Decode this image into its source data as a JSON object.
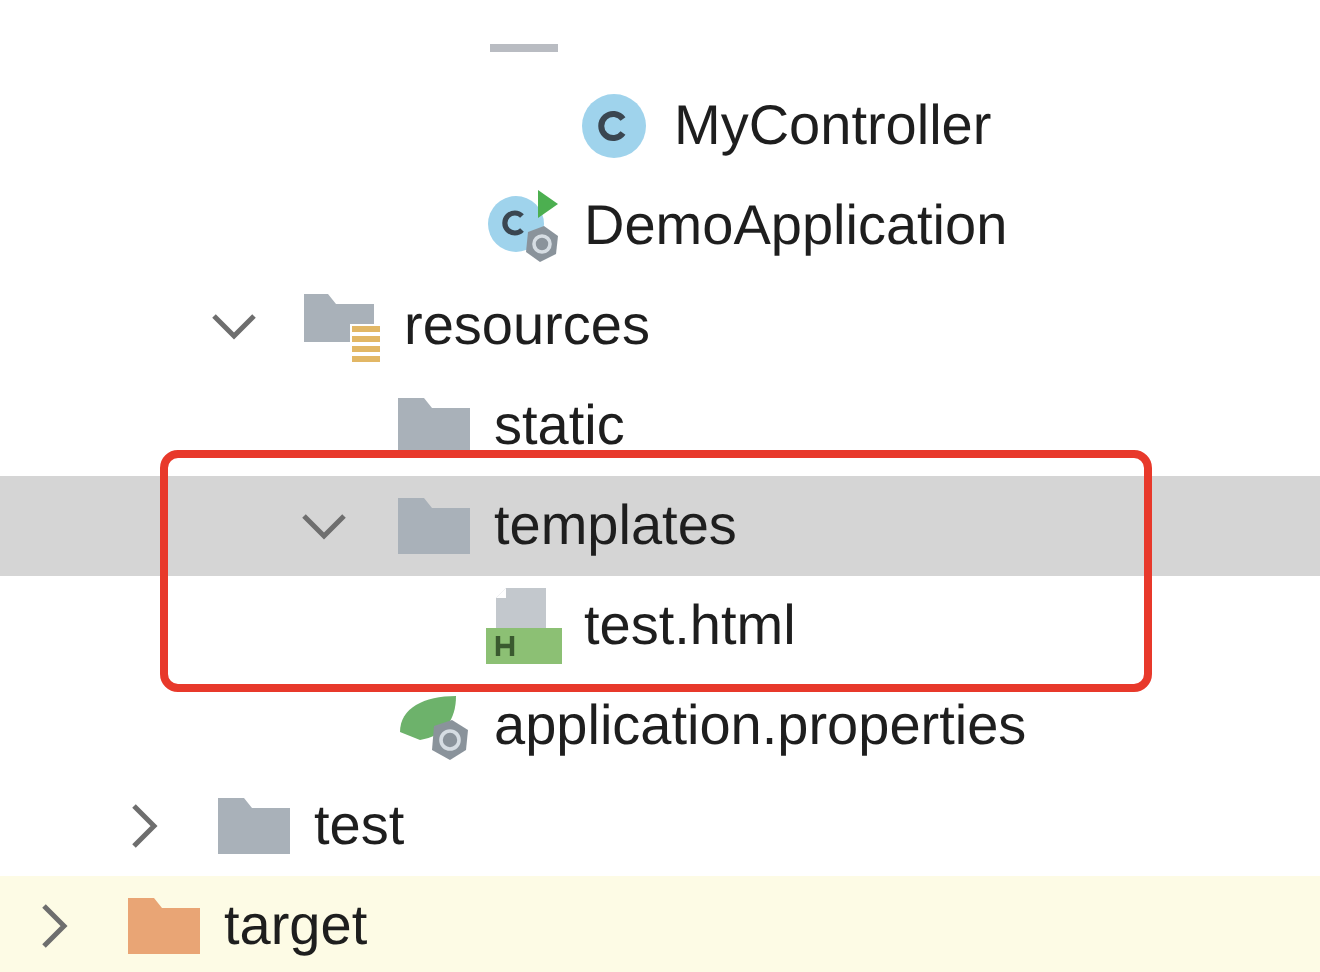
{
  "project_tree": [
    {
      "children": [
        {
          "children": [
            {
              "children": [
                {
                  "children": [
                    {
                      "kind": "package",
                      "children": [
                        {
                          "kind": "class",
                          "label": "MyController",
                          "selected": false
                        }
                      ]
                    },
                    {
                      "kind": "spring-app",
                      "label": "DemoApplication",
                      "selected": false
                    }
                  ]
                }
              ]
            },
            {
              "kind": "resources-folder",
              "label": "resources",
              "expanded": true,
              "selected": false,
              "children": [
                {
                  "kind": "folder",
                  "label": "static",
                  "selected": false
                },
                {
                  "kind": "folder",
                  "label": "templates",
                  "expanded": true,
                  "selected": true,
                  "annotated": true,
                  "children": [
                    {
                      "kind": "html",
                      "label": "test.html",
                      "selected": false
                    }
                  ]
                },
                {
                  "kind": "properties",
                  "label": "application.properties",
                  "selected": false
                }
              ]
            }
          ]
        },
        {
          "kind": "folder",
          "label": "test",
          "expanded": false,
          "selected": false
        }
      ]
    },
    {
      "kind": "excluded-folder",
      "label": "target",
      "expanded": false,
      "selected": false
    }
  ]
}
